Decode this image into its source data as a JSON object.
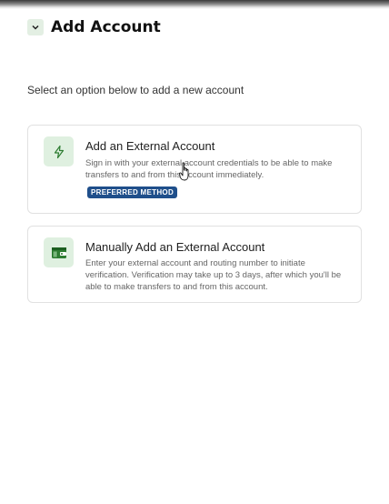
{
  "header": {
    "title": "Add Account",
    "collapse_icon": "chevron-down-icon"
  },
  "subtitle": "Select an option below to add a new account",
  "options": [
    {
      "title": "Add an External Account",
      "description": "Sign in with your external account credentials to be able to make transfers to and from this account immediately.",
      "badge": "PREFERRED METHOD",
      "icon": "lightning-icon"
    },
    {
      "title": "Manually Add an External Account",
      "description": "Enter your external account and routing number to initiate verification. Verification may take up to 3 days, after which you'll be able to make transfers to and from this account.",
      "icon": "wallet-icon"
    }
  ],
  "colors": {
    "accent_green": "#2e7d32",
    "icon_bg": "#dff0e0",
    "badge_bg": "#1f4f8b"
  }
}
